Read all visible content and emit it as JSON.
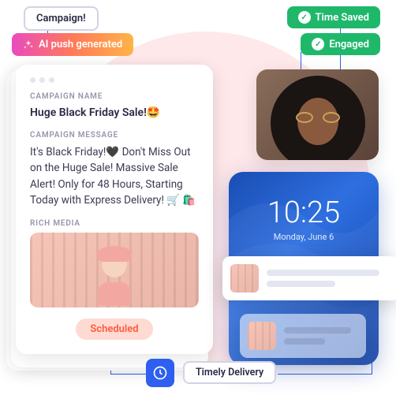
{
  "chips": {
    "campaign": "Campaign!",
    "ai_push": "AI push generated",
    "timely": "Timely Delivery"
  },
  "badges": {
    "time_saved": "Time Saved",
    "engaged": "Engaged"
  },
  "card": {
    "labels": {
      "name": "CAMPAIGN NAME",
      "message": "CAMPAIGN MESSAGE",
      "rich": "RICH MEDIA"
    },
    "name_value": "Huge Black Friday Sale!🤩",
    "message_value": "It's Black Friday!🖤 Don't Miss Out on the Huge Sale! Massive Sale Alert! Only for 48 Hours, Starting Today with Express Delivery! 🛒 🛍️",
    "status": "Scheduled"
  },
  "phone": {
    "time": "10:25",
    "date": "Monday, June 6"
  },
  "icons": {
    "sparkle": "sparkle-icon",
    "check": "check-icon",
    "clock": "clock-icon"
  }
}
